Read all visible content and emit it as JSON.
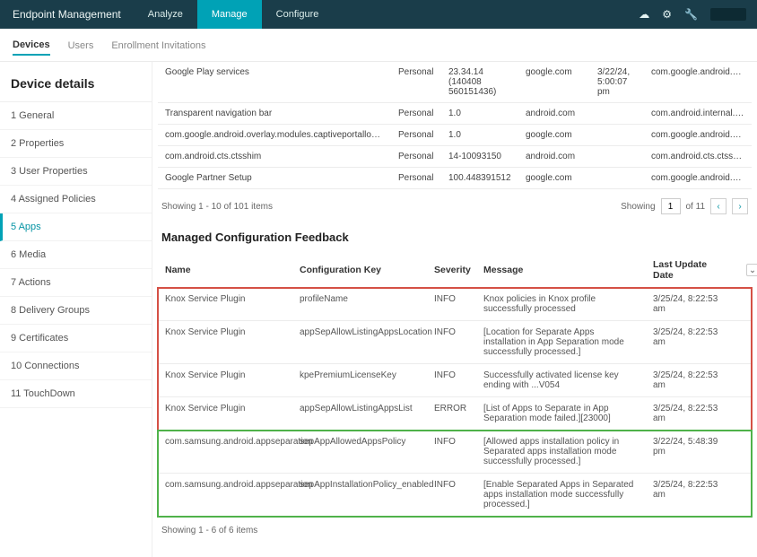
{
  "header": {
    "brand": "Endpoint Management",
    "tabs": [
      "Analyze",
      "Manage",
      "Configure"
    ],
    "active_tab": "Manage"
  },
  "subnav": {
    "tabs": [
      "Devices",
      "Users",
      "Enrollment Invitations"
    ],
    "active": "Devices"
  },
  "sidebar": {
    "title": "Device details",
    "items": [
      {
        "label": "1  General"
      },
      {
        "label": "2  Properties"
      },
      {
        "label": "3  User Properties"
      },
      {
        "label": "4  Assigned Policies"
      },
      {
        "label": "5  Apps"
      },
      {
        "label": "6  Media"
      },
      {
        "label": "7  Actions"
      },
      {
        "label": "8  Delivery Groups"
      },
      {
        "label": "9  Certificates"
      },
      {
        "label": "10  Connections"
      },
      {
        "label": "11  TouchDown"
      }
    ],
    "active_index": 4
  },
  "apps_table": {
    "rows": [
      {
        "name": "Google Play services",
        "personal": "Personal",
        "ver": "23.34.14 (140408 560151436)",
        "vendor": "google.com",
        "date": "3/22/24, 5:00:07 pm",
        "pkg": "com.google.android.gms"
      },
      {
        "name": "Transparent navigation bar",
        "personal": "Personal",
        "ver": "1.0",
        "vendor": "android.com",
        "date": "",
        "pkg": "com.android.internal.systemu"
      },
      {
        "name": "com.google.android.overlay.modules.captiveportallogin.forframework",
        "personal": "Personal",
        "ver": "1.0",
        "vendor": "google.com",
        "date": "",
        "pkg": "com.google.android.overlay.m"
      },
      {
        "name": "com.android.cts.ctsshim",
        "personal": "Personal",
        "ver": "14-10093150",
        "vendor": "android.com",
        "date": "",
        "pkg": "com.android.cts.ctsshim"
      },
      {
        "name": "Google Partner Setup",
        "personal": "Personal",
        "ver": "100.448391512",
        "vendor": "google.com",
        "date": "",
        "pkg": "com.google.android.partners"
      }
    ],
    "showing": "Showing 1 - 10 of 101 items",
    "pager": {
      "showing_label": "Showing",
      "page": "1",
      "of_label": "of 11"
    }
  },
  "feedback": {
    "title": "Managed Configuration Feedback",
    "headers": {
      "name": "Name",
      "key": "Configuration Key",
      "sev": "Severity",
      "msg": "Message",
      "date": "Last Update Date"
    },
    "rows": [
      {
        "name": "Knox Service Plugin",
        "key": "profileName",
        "sev": "INFO",
        "msg": "Knox policies in Knox profile successfully processed",
        "date": "3/25/24, 8:22:53 am",
        "group": "red"
      },
      {
        "name": "Knox Service Plugin",
        "key": "appSepAllowListingAppsLocation",
        "sev": "INFO",
        "msg": "[Location for Separate Apps installation in App Separation mode successfully processed.]",
        "date": "3/25/24, 8:22:53 am",
        "group": "red"
      },
      {
        "name": "Knox Service Plugin",
        "key": "kpePremiumLicenseKey",
        "sev": "INFO",
        "msg": "Successfully activated license key ending with ...V054",
        "date": "3/25/24, 8:22:53 am",
        "group": "red"
      },
      {
        "name": "Knox Service Plugin",
        "key": "appSepAllowListingAppsList",
        "sev": "ERROR",
        "msg": "[List of Apps to Separate in App Separation mode failed.][23000]",
        "date": "3/25/24, 8:22:53 am",
        "group": "red"
      },
      {
        "name": "com.samsung.android.appseparation",
        "key": "sepAppAllowedAppsPolicy",
        "sev": "INFO",
        "msg": "[Allowed apps installation policy in Separated apps installation mode successfully processed.]",
        "date": "3/22/24, 5:48:39 pm",
        "group": "green"
      },
      {
        "name": "com.samsung.android.appseparation",
        "key": "sepAppInstallationPolicy_enabled",
        "sev": "INFO",
        "msg": "[Enable Separated Apps in Separated apps installation mode successfully processed.]",
        "date": "3/25/24, 8:22:53 am",
        "group": "green"
      }
    ],
    "showing": "Showing 1 - 6 of 6 items"
  }
}
